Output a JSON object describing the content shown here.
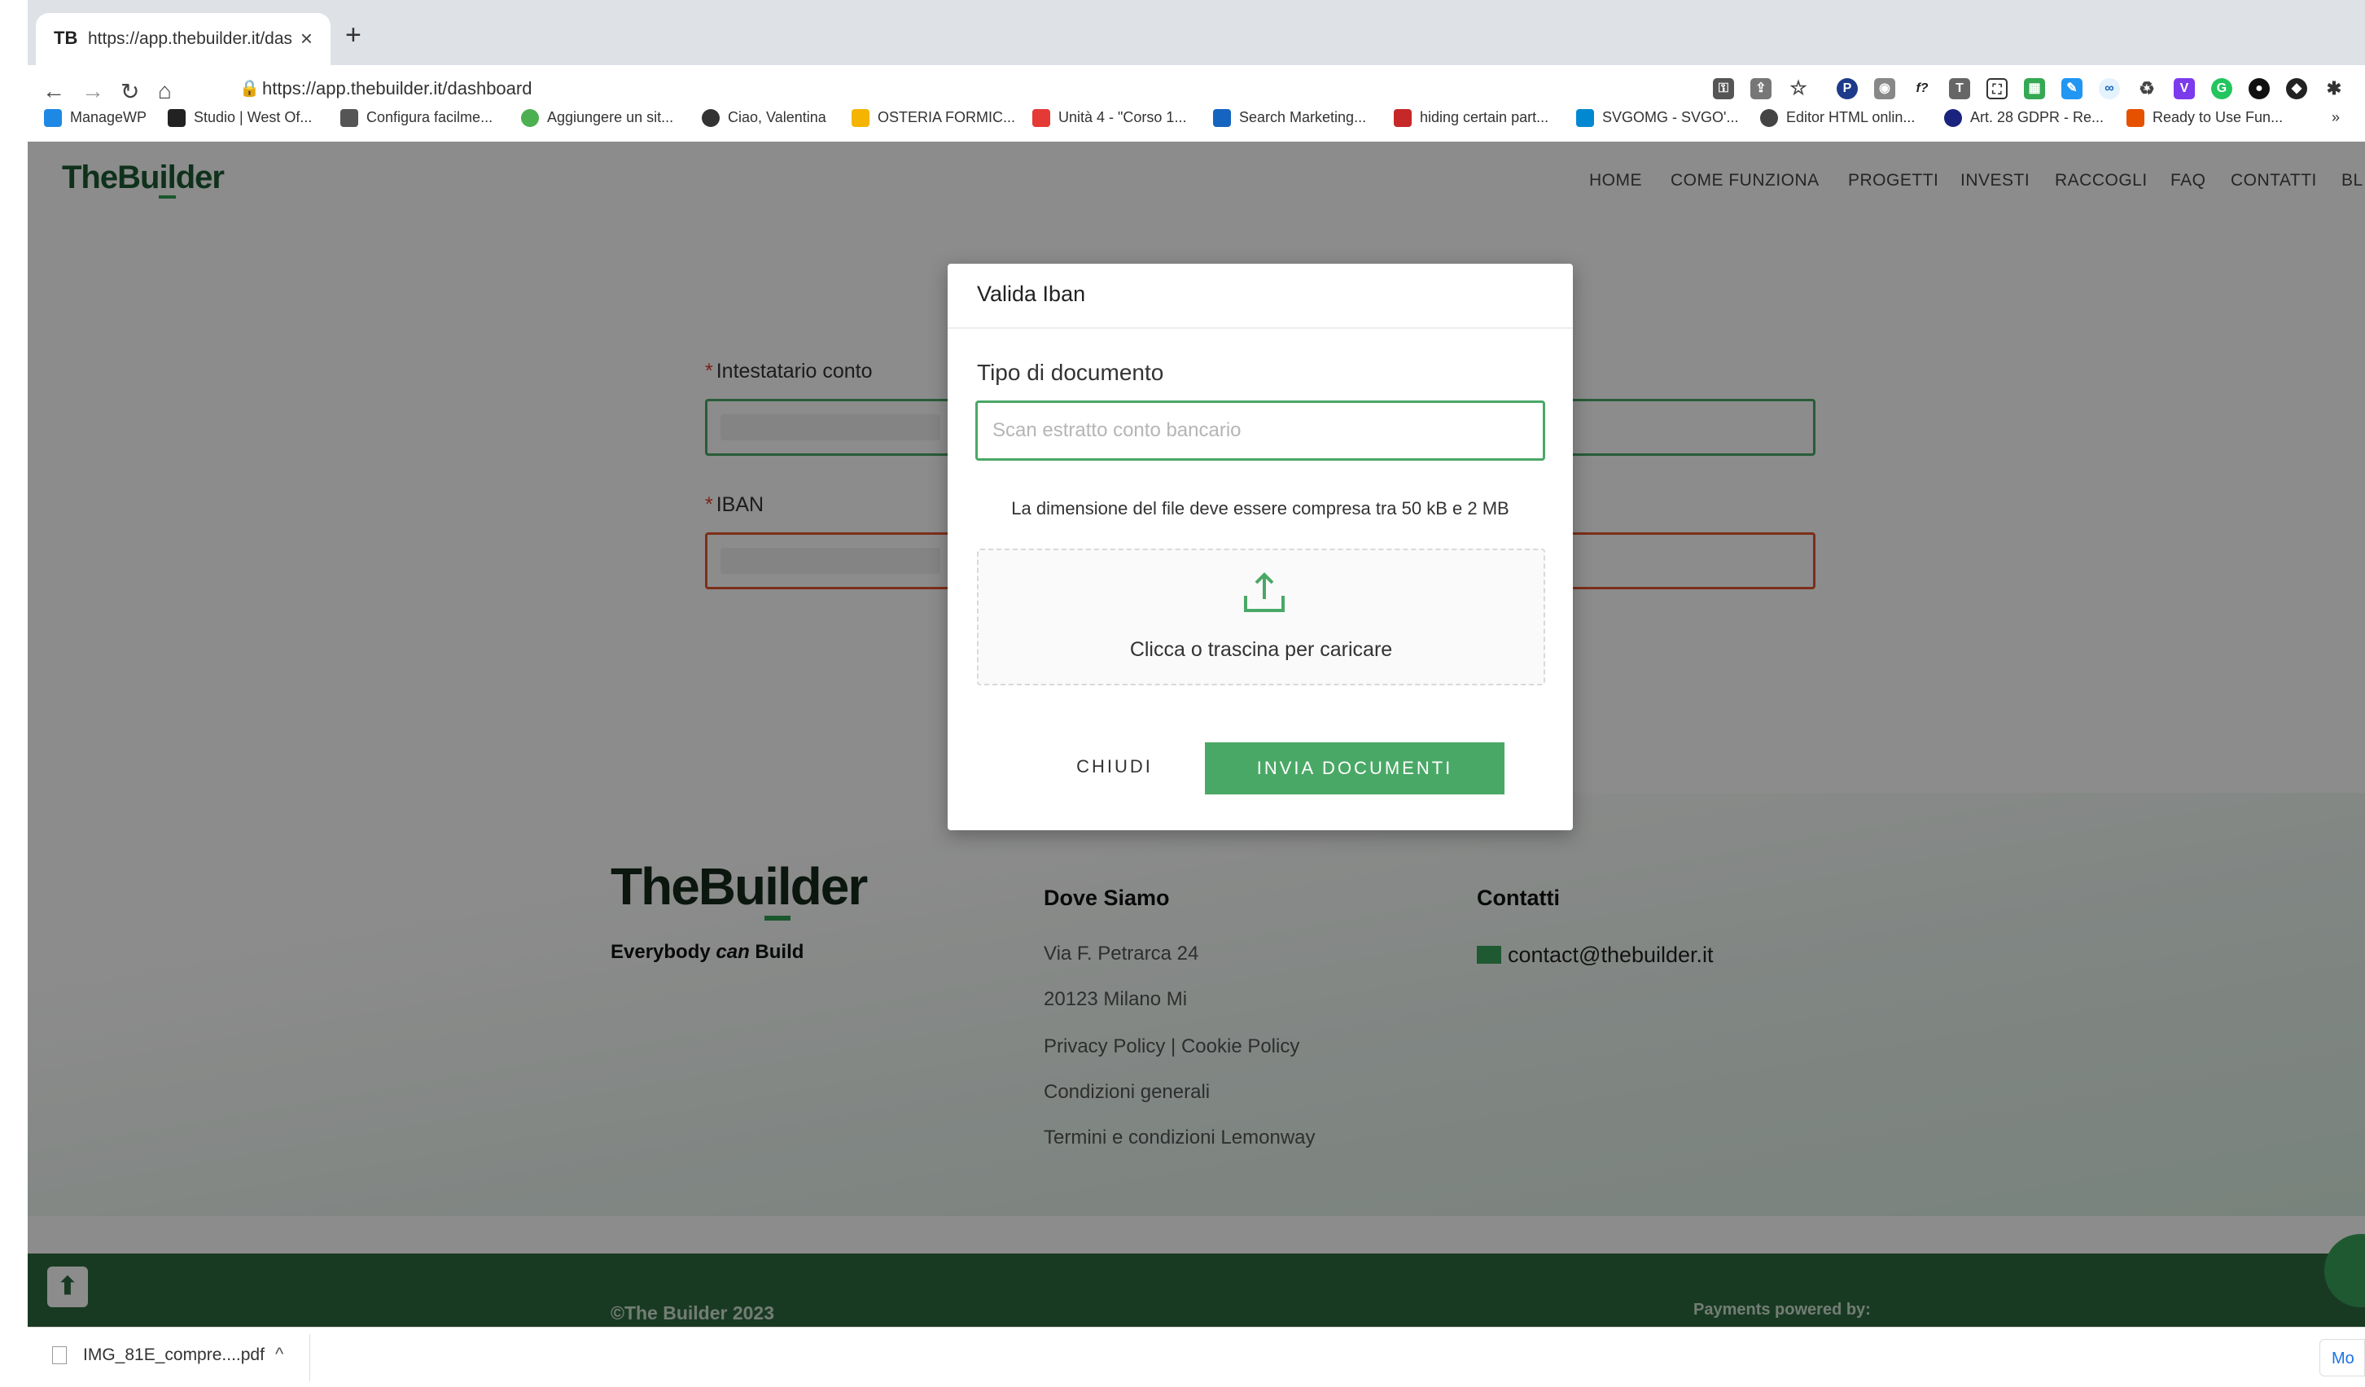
{
  "browser": {
    "tab_favicon": "TB",
    "tab_title": "https://app.thebuilder.it/dashb",
    "tab_close": "×",
    "new_tab": "+",
    "url": "https://app.thebuilder.it/dashboard",
    "back": "←",
    "forward": "→",
    "reload": "↻",
    "home": "⌂",
    "bookmarks": [
      {
        "label": "ManageWP",
        "icon": "managewp-icon",
        "color": "#1e88e5"
      },
      {
        "label": "Studio | West Of...",
        "icon": "studio-icon",
        "color": "#222222"
      },
      {
        "label": "Configura facilme...",
        "icon": "configura-icon",
        "color": "#555555"
      },
      {
        "label": "Aggiungere un sit...",
        "icon": "aggiungere-icon",
        "color": "#4caf50"
      },
      {
        "label": "Ciao, Valentina",
        "icon": "ciao-icon",
        "color": "#333333"
      },
      {
        "label": "OSTERIA FORMIC...",
        "icon": "drive-icon",
        "color": "#f4b400"
      },
      {
        "label": "Unità 4 - \"Corso 1...",
        "icon": "unita-icon",
        "color": "#e53935"
      },
      {
        "label": "Search Marketing...",
        "icon": "search-marketing-icon",
        "color": "#1565c0"
      },
      {
        "label": "hiding certain part...",
        "icon": "hiding-icon",
        "color": "#c62828"
      },
      {
        "label": "SVGOMG - SVGO'...",
        "icon": "svgomg-icon",
        "color": "#0288d1"
      },
      {
        "label": "Editor HTML onlin...",
        "icon": "editor-icon",
        "color": "#444444"
      },
      {
        "label": "Art. 28 GDPR - Re...",
        "icon": "gdpr-icon",
        "color": "#1a237e"
      },
      {
        "label": "Ready to Use Fun...",
        "icon": "ready-icon",
        "color": "#e65100"
      }
    ],
    "bookmarks_more": "»",
    "download_file": "IMG_81E_compre....pdf",
    "download_chevron": "^",
    "download_more": "Mo"
  },
  "site": {
    "logo": {
      "pre": "The",
      "mid": "Bu",
      "u": "il",
      "post": "der"
    },
    "nav": [
      "HOME",
      "COME FUNZIONA",
      "PROGETTI",
      "INVESTI",
      "RACCOGLI",
      "FAQ",
      "CONTATTI",
      "BL"
    ],
    "form": {
      "required_mark": "*",
      "holder_label": "Intestatario conto",
      "iban_label": "IBAN"
    },
    "footer": {
      "tagline_pre": "Everybody ",
      "tagline_em": "can",
      "tagline_post": " Build",
      "where_title": "Dove Siamo",
      "address1": "Via F. Petrarca 24",
      "address2": "20123 Milano Mi",
      "privacy": "Privacy Policy",
      "pipe": " | ",
      "cookie": "Cookie Policy",
      "conditions": "Condizioni generali",
      "lemonway": "Termini e condizioni Lemonway",
      "contacts_title": "Contatti",
      "email": "contact@thebuilder.it",
      "copyright": "©The Builder 2023",
      "payments": "Payments powered by:"
    }
  },
  "modal": {
    "title": "Valida Iban",
    "doc_type_label": "Tipo di documento",
    "doc_type_placeholder": "Scan estratto conto bancario",
    "size_hint": "La dimensione del file deve essere compresa tra 50 kB e 2 MB",
    "upload_text": "Clicca o trascina per caricare",
    "close_label": "CHIUDI",
    "submit_label": "INVIA DOCUMENTI"
  },
  "colors": {
    "brand_green": "#4aa866",
    "dark_green": "#2e6b3e",
    "error_red": "#e4572e"
  }
}
